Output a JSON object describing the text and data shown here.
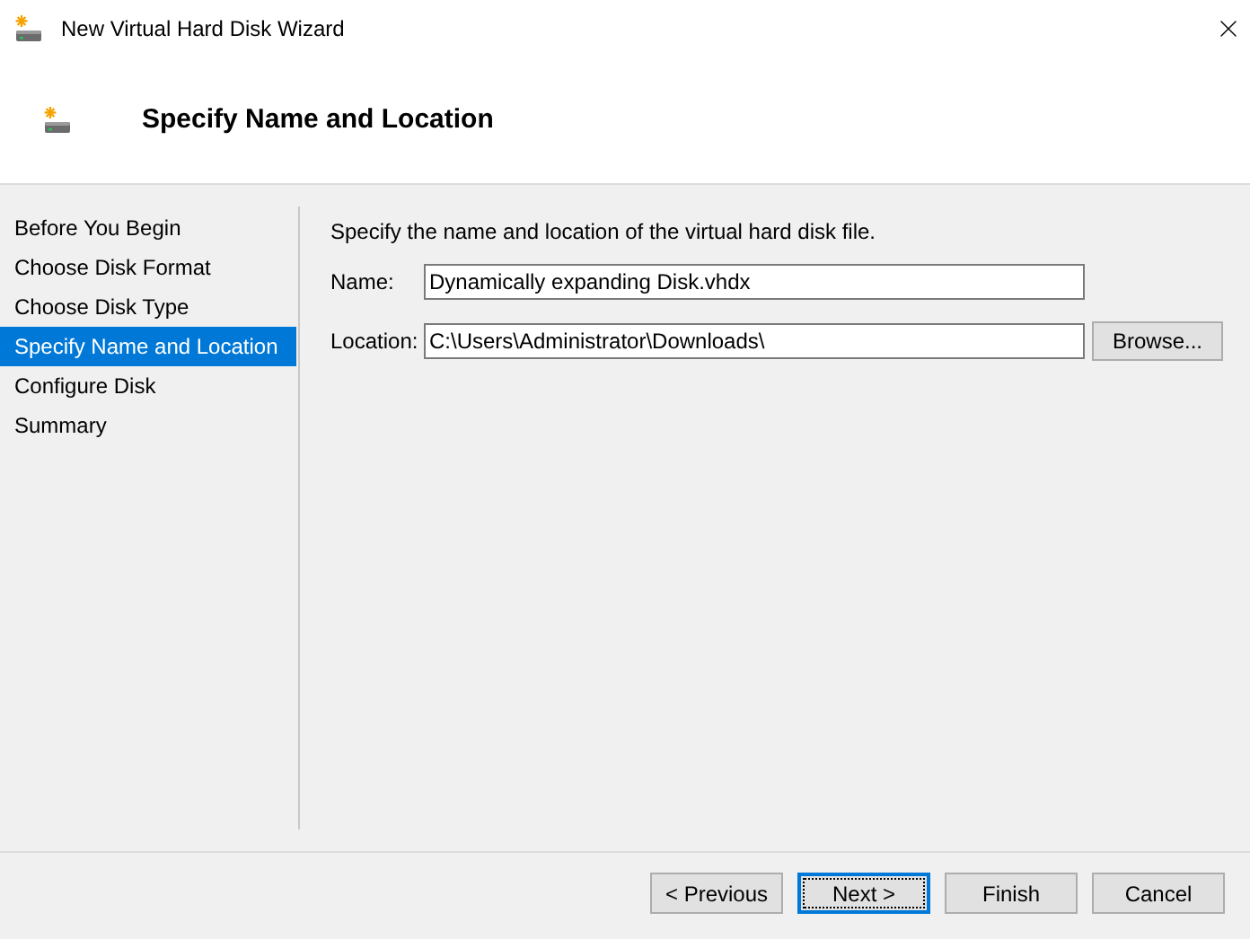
{
  "window": {
    "title": "New Virtual Hard Disk Wizard"
  },
  "header": {
    "title": "Specify Name and Location"
  },
  "sidebar": {
    "items": [
      {
        "label": "Before You Begin",
        "selected": false
      },
      {
        "label": "Choose Disk Format",
        "selected": false
      },
      {
        "label": "Choose Disk Type",
        "selected": false
      },
      {
        "label": "Specify Name and Location",
        "selected": true
      },
      {
        "label": "Configure Disk",
        "selected": false
      },
      {
        "label": "Summary",
        "selected": false
      }
    ]
  },
  "content": {
    "instruction": "Specify the name and location of the virtual hard disk file.",
    "name_field": {
      "label": "Name:",
      "value": "Dynamically expanding Disk.vhdx"
    },
    "location_field": {
      "label": "Location:",
      "value": "C:\\Users\\Administrator\\Downloads\\"
    },
    "browse_button": "Browse..."
  },
  "buttons": [
    {
      "label": "< Previous",
      "focused": false
    },
    {
      "label": "Next >",
      "focused": true
    },
    {
      "label": "Finish",
      "focused": false
    },
    {
      "label": "Cancel",
      "focused": false
    }
  ]
}
